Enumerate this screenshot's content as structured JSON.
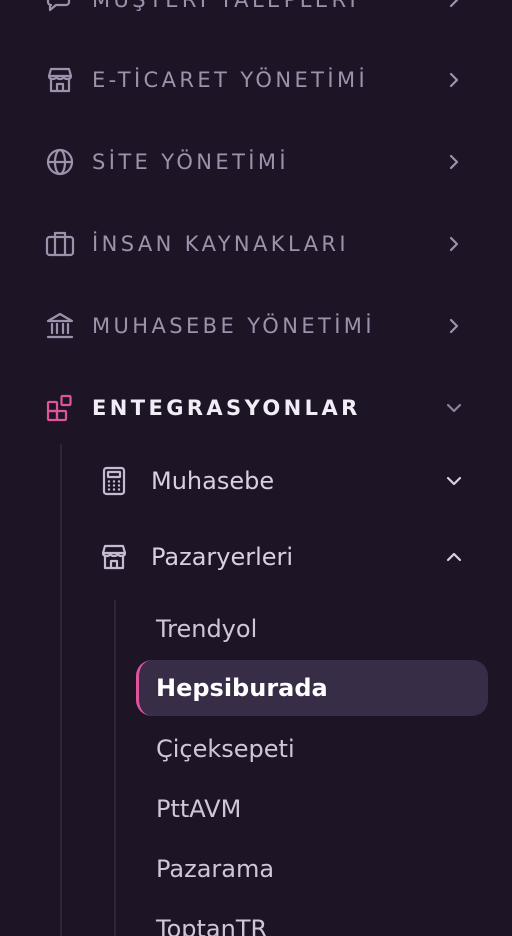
{
  "menu": {
    "items": [
      {
        "label": "MÜŞTERİ TALEPLERİ",
        "icon": "chat-icon"
      },
      {
        "label": "E-TİCARET YÖNETİMİ",
        "icon": "store-icon"
      },
      {
        "label": "SİTE YÖNETİMİ",
        "icon": "globe-icon"
      },
      {
        "label": "İNSAN KAYNAKLARI",
        "icon": "briefcase-icon"
      },
      {
        "label": "MUHASEBE YÖNETİMİ",
        "icon": "bank-icon"
      },
      {
        "label": "ENTEGRASYONLAR",
        "icon": "integrations-icon",
        "expanded": true
      }
    ],
    "integrations": {
      "sub_items": [
        {
          "label": "Muhasebe",
          "icon": "calculator-icon",
          "expanded": false
        },
        {
          "label": "Pazaryerleri",
          "icon": "store-icon",
          "expanded": true
        }
      ],
      "marketplaces": [
        {
          "label": "Trendyol"
        },
        {
          "label": "Hepsiburada",
          "selected": true
        },
        {
          "label": "Çiçeksepeti"
        },
        {
          "label": "PttAVM"
        },
        {
          "label": "Pazarama"
        },
        {
          "label": "ToptanTR"
        }
      ]
    }
  },
  "colors": {
    "background": "#1d1526",
    "accent": "#e0559a",
    "selected_bg": "#382d46",
    "muted_text": "#9d92ab"
  }
}
